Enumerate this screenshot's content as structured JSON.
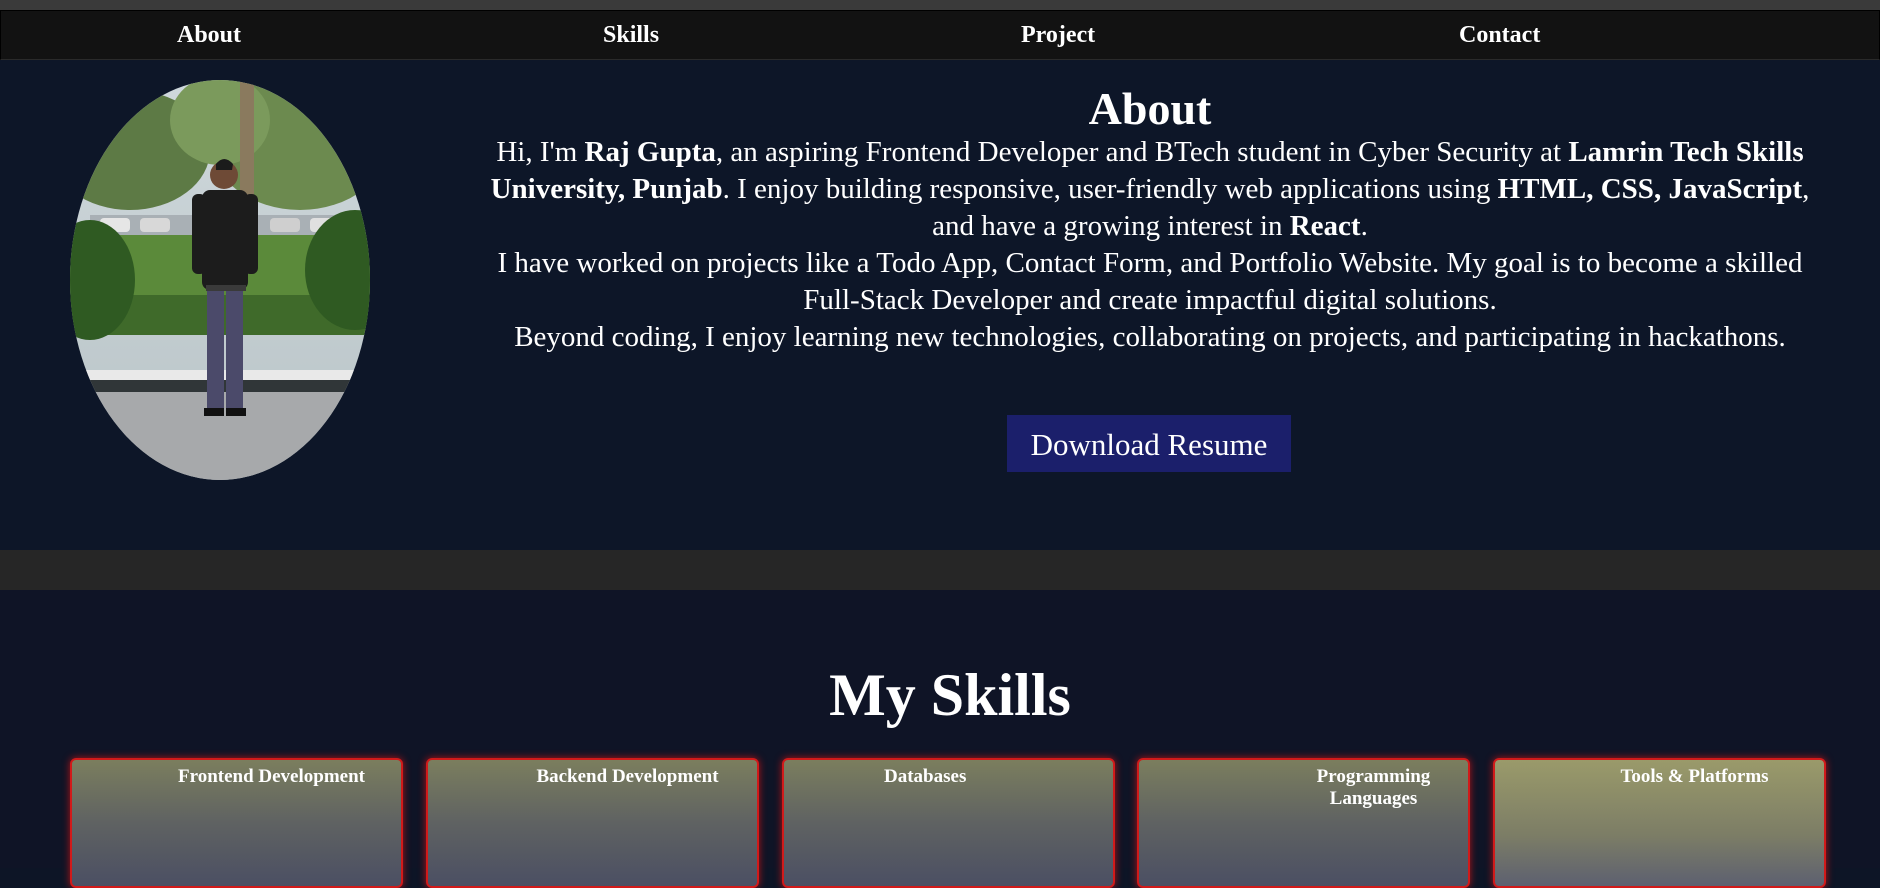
{
  "nav": {
    "items": [
      {
        "label": "About"
      },
      {
        "label": "Skills"
      },
      {
        "label": "Project"
      },
      {
        "label": "Contact"
      }
    ]
  },
  "about": {
    "title": "About",
    "paragraph1": {
      "t1": "Hi, I'm ",
      "b1": "Raj Gupta",
      "t2": ", an aspiring Frontend Developer and BTech student in Cyber Security at ",
      "b2": "Lamrin Tech Skills University, Punjab",
      "t3": ". I enjoy building responsive, user-friendly web applications using ",
      "b3": "HTML, CSS, JavaScript",
      "t4": ", and have a growing interest in ",
      "b4": "React",
      "t5": "."
    },
    "paragraph2": "I have worked on projects like a Todo App, Contact Form, and Portfolio Website. My goal is to become a skilled Full-Stack Developer and create impactful digital solutions.",
    "paragraph3": "Beyond coding, I enjoy learning new technologies, collaborating on projects, and participating in hackathons.",
    "resume_button": "Download Resume"
  },
  "skills": {
    "title": "My Skills",
    "cards": [
      {
        "title": "Frontend Development"
      },
      {
        "title": "Backend Development"
      },
      {
        "title": "Databases"
      },
      {
        "title": "Programming Languages"
      },
      {
        "title": "Tools & Platforms"
      }
    ]
  },
  "colors": {
    "page_bg": "#0d1526",
    "navbar_bg": "#121212",
    "button_bg": "#1b1f6b",
    "card_border": "#d11a1a"
  }
}
